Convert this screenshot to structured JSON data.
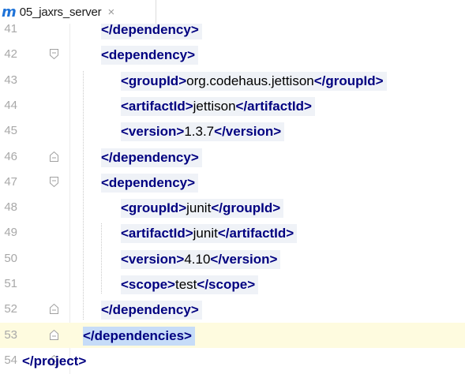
{
  "tab": {
    "icon": "maven-icon",
    "icon_glyph": "m",
    "title": "05_jaxrs_server",
    "close_glyph": "×"
  },
  "editor": {
    "lines": [
      {
        "num": "41",
        "parts": [
          {
            "t": "tag",
            "v": "</dependency>"
          }
        ]
      },
      {
        "num": "42",
        "parts": [
          {
            "t": "tag",
            "v": "<dependency>"
          }
        ]
      },
      {
        "num": "43",
        "parts": [
          {
            "t": "tag",
            "v": "<groupId>"
          },
          {
            "t": "txt",
            "v": "org.codehaus.jettison"
          },
          {
            "t": "tag",
            "v": "</groupId>"
          }
        ]
      },
      {
        "num": "44",
        "parts": [
          {
            "t": "tag",
            "v": "<artifactId>"
          },
          {
            "t": "txt",
            "v": "jettison"
          },
          {
            "t": "tag",
            "v": "</artifactId>"
          }
        ]
      },
      {
        "num": "45",
        "parts": [
          {
            "t": "tag",
            "v": "<version>"
          },
          {
            "t": "txt",
            "v": "1.3.7"
          },
          {
            "t": "tag",
            "v": "</version>"
          }
        ]
      },
      {
        "num": "46",
        "parts": [
          {
            "t": "tag",
            "v": "</dependency>"
          }
        ]
      },
      {
        "num": "47",
        "parts": [
          {
            "t": "tag",
            "v": "<dependency>"
          }
        ]
      },
      {
        "num": "48",
        "parts": [
          {
            "t": "tag",
            "v": "<groupId>"
          },
          {
            "t": "txt",
            "v": "junit"
          },
          {
            "t": "tag",
            "v": "</groupId>"
          }
        ]
      },
      {
        "num": "49",
        "parts": [
          {
            "t": "tag",
            "v": "<artifactId>"
          },
          {
            "t": "txt",
            "v": "junit"
          },
          {
            "t": "tag",
            "v": "</artifactId>"
          }
        ]
      },
      {
        "num": "50",
        "parts": [
          {
            "t": "tag",
            "v": "<version>"
          },
          {
            "t": "txt",
            "v": "4.10"
          },
          {
            "t": "tag",
            "v": "</version>"
          }
        ]
      },
      {
        "num": "51",
        "parts": [
          {
            "t": "tag",
            "v": "<scope>"
          },
          {
            "t": "txt",
            "v": "test"
          },
          {
            "t": "tag",
            "v": "</scope>"
          }
        ]
      },
      {
        "num": "52",
        "parts": [
          {
            "t": "tag",
            "v": "</dependency>"
          }
        ]
      },
      {
        "num": "53",
        "parts": [
          {
            "t": "tag",
            "v": "</dependencies>"
          }
        ]
      },
      {
        "num": "54",
        "parts": [
          {
            "t": "tag",
            "v": "</project>"
          }
        ]
      }
    ]
  },
  "colors": {
    "tag": "#000080",
    "text": "#000000",
    "line_number": "#a8a8a8",
    "current_line": "#fefbdf",
    "selection": "#c6dcf8"
  }
}
